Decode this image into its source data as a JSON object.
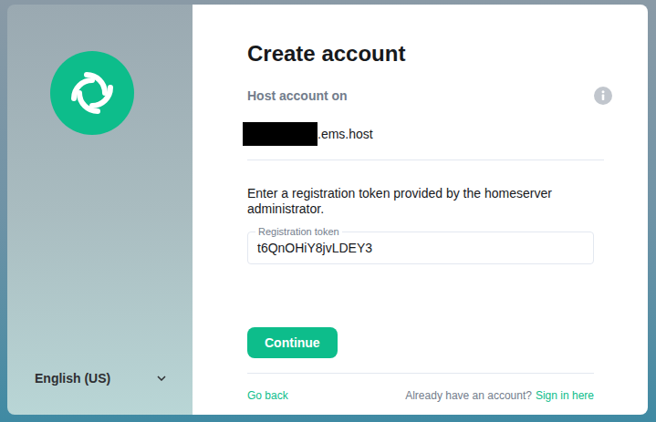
{
  "left_panel": {
    "language": "English (US)"
  },
  "form": {
    "title": "Create account",
    "host_label": "Host account on",
    "server": ".ems.host",
    "instructions": "Enter a registration token provided by the homeserver administrator.",
    "field": {
      "label": "Registration token",
      "value": "t6QnOHiY8jvLDEY3"
    },
    "button": "Continue"
  },
  "footer": {
    "back": "Go back",
    "prompt": "Already have an account?",
    "sign_in": "Sign in here"
  }
}
